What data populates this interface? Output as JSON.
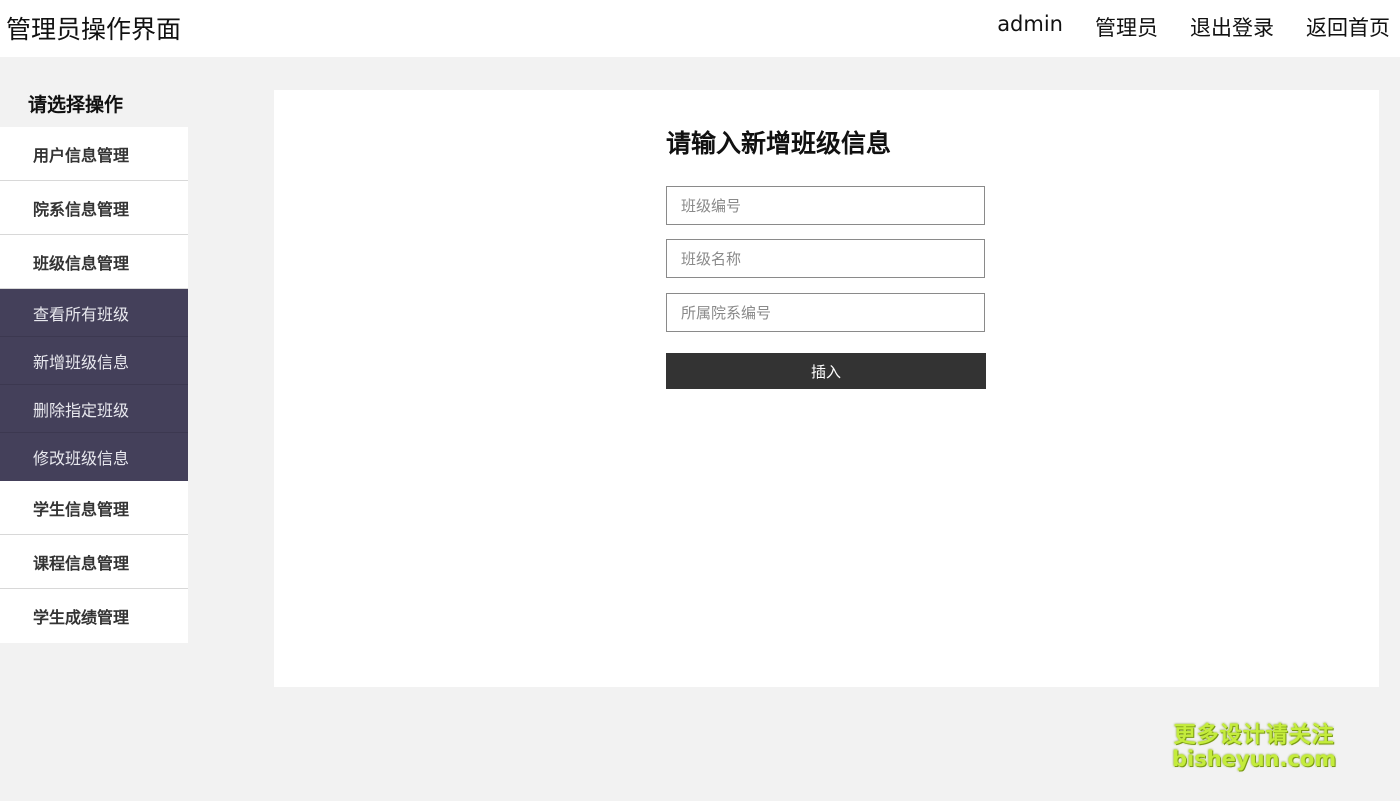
{
  "header": {
    "title": "管理员操作界面",
    "nav": [
      "admin",
      "管理员",
      "退出登录",
      "返回首页"
    ]
  },
  "sidebar": {
    "title": "请选择操作",
    "items": [
      {
        "label": "用户信息管理"
      },
      {
        "label": "院系信息管理"
      },
      {
        "label": "班级信息管理"
      }
    ],
    "submenu": [
      "查看所有班级",
      "新增班级信息",
      "删除指定班级",
      "修改班级信息"
    ],
    "items_after": [
      {
        "label": "学生信息管理"
      },
      {
        "label": "课程信息管理"
      },
      {
        "label": "学生成绩管理"
      }
    ],
    "submenu_bg": "#44405a"
  },
  "form": {
    "title": "请输入新增班级信息",
    "fields": [
      {
        "placeholder": "班级编号",
        "value": ""
      },
      {
        "placeholder": "班级名称",
        "value": ""
      },
      {
        "placeholder": "所属院系编号",
        "value": ""
      }
    ],
    "submit_label": "插入",
    "submit_bg": "#333333"
  },
  "watermark": {
    "line1": "更多设计请关注",
    "line2": "bisheyun.com",
    "color": "#c4ec3c"
  }
}
